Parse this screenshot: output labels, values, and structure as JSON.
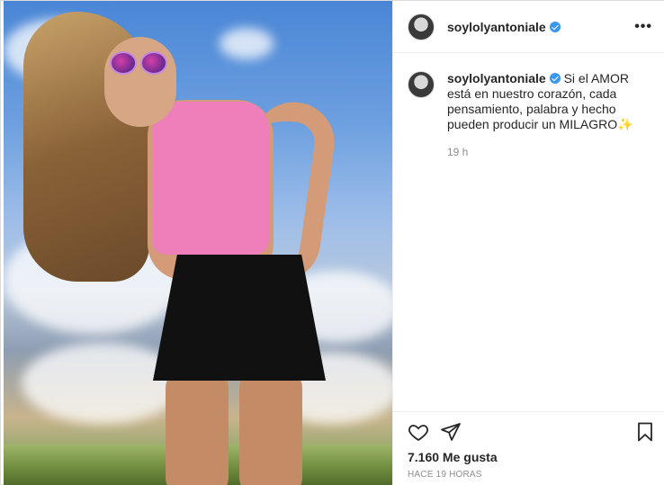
{
  "post": {
    "author": {
      "username": "soylolyantoniale",
      "verified": true
    },
    "caption": "Si el AMOR está en nuestro corazón, cada pensamiento, palabra y hecho pueden producir un MILAGRO✨",
    "caption_time": "19 h",
    "likes": "7.160 Me gusta",
    "posted_ago": "HACE 19 HORAS"
  },
  "icons": {
    "more": "more-options-icon",
    "like": "heart-icon",
    "share": "paper-plane-icon",
    "save": "bookmark-icon",
    "verified": "verified-badge-icon"
  },
  "colors": {
    "verified": "#3897f0",
    "muted": "#8e8e8e",
    "text": "#262626"
  }
}
